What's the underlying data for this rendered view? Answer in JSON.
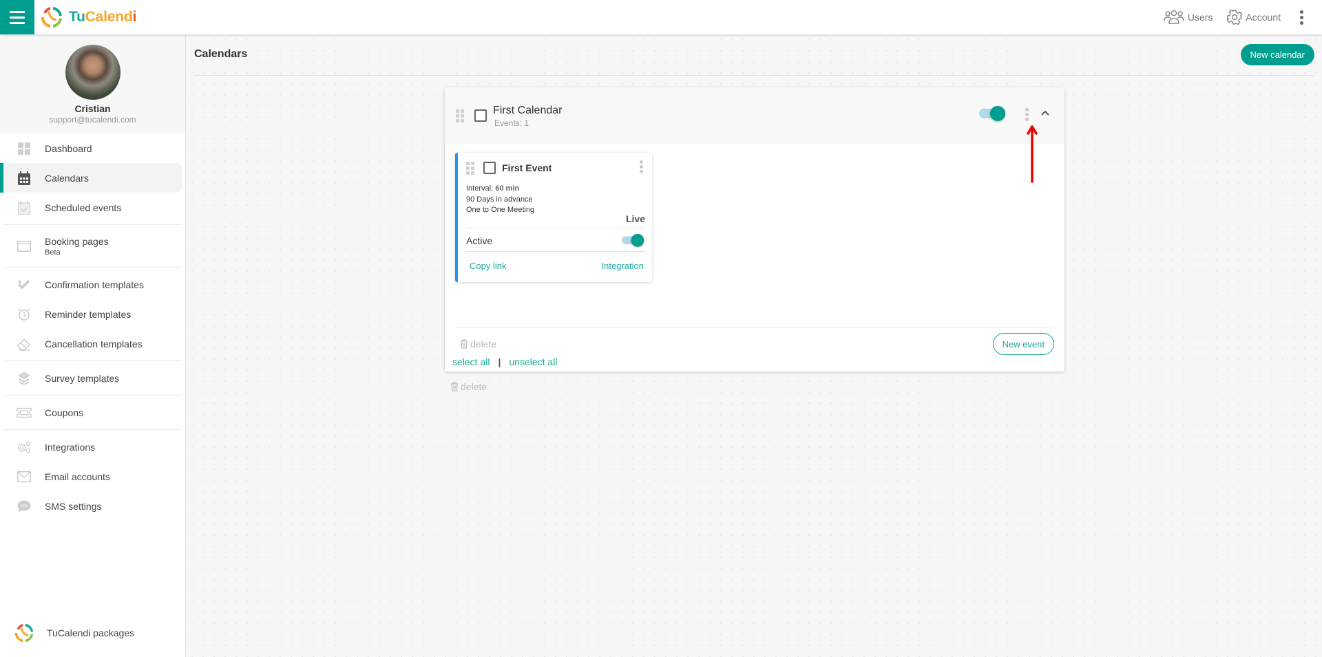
{
  "app": {
    "brand_parts": [
      "Tu",
      "Calend",
      "i"
    ],
    "brand_colors": {
      "tu": "#17a89a",
      "calend": "#f5a623",
      "i": "#e8532c"
    },
    "accent": "#009e8f"
  },
  "topbar": {
    "menu_icon": "hamburger-icon",
    "users_label": "Users",
    "account_label": "Account",
    "more_icon": "kebab-vertical-icon"
  },
  "profile": {
    "name": "Cristian",
    "email": "support@tucalendi.com"
  },
  "sidebar": {
    "items": [
      {
        "label": "Dashboard",
        "icon": "dashboard-icon"
      },
      {
        "label": "Calendars",
        "icon": "calendar-icon",
        "active": true
      },
      {
        "label": "Scheduled events",
        "icon": "calendar-check-icon"
      },
      {
        "label": "Booking pages",
        "sub": "Beta",
        "icon": "browser-window-icon"
      },
      {
        "label": "Confirmation templates",
        "icon": "double-check-icon"
      },
      {
        "label": "Reminder templates",
        "icon": "alarm-clock-icon"
      },
      {
        "label": "Cancellation templates",
        "icon": "eraser-icon"
      },
      {
        "label": "Survey templates",
        "icon": "layers-icon"
      },
      {
        "label": "Coupons",
        "icon": "ticket-icon"
      },
      {
        "label": "Integrations",
        "icon": "gears-icon"
      },
      {
        "label": "Email accounts",
        "icon": "envelope-icon"
      },
      {
        "label": "SMS settings",
        "icon": "sms-bubble-icon"
      }
    ],
    "packages_label": "TuCalendi packages"
  },
  "main": {
    "title": "Calendars",
    "new_calendar_label": "New calendar",
    "calendar": {
      "title": "First Calendar",
      "events_count": "Events: 1",
      "enabled": true,
      "delete_label": "delete",
      "new_event_label": "New event",
      "event": {
        "title": "First Event",
        "interval_label": "Interval:",
        "interval_value": "60 min",
        "advance": "90 Days in advance",
        "type": "One to One Meeting",
        "status": "Live",
        "active_label": "Active",
        "active": true,
        "copy_link_label": "Copy link",
        "integration_label": "Integration"
      }
    },
    "select_all_label": "select all",
    "separator": "|",
    "unselect_all_label": "unselect all",
    "delete_label": "delete"
  }
}
